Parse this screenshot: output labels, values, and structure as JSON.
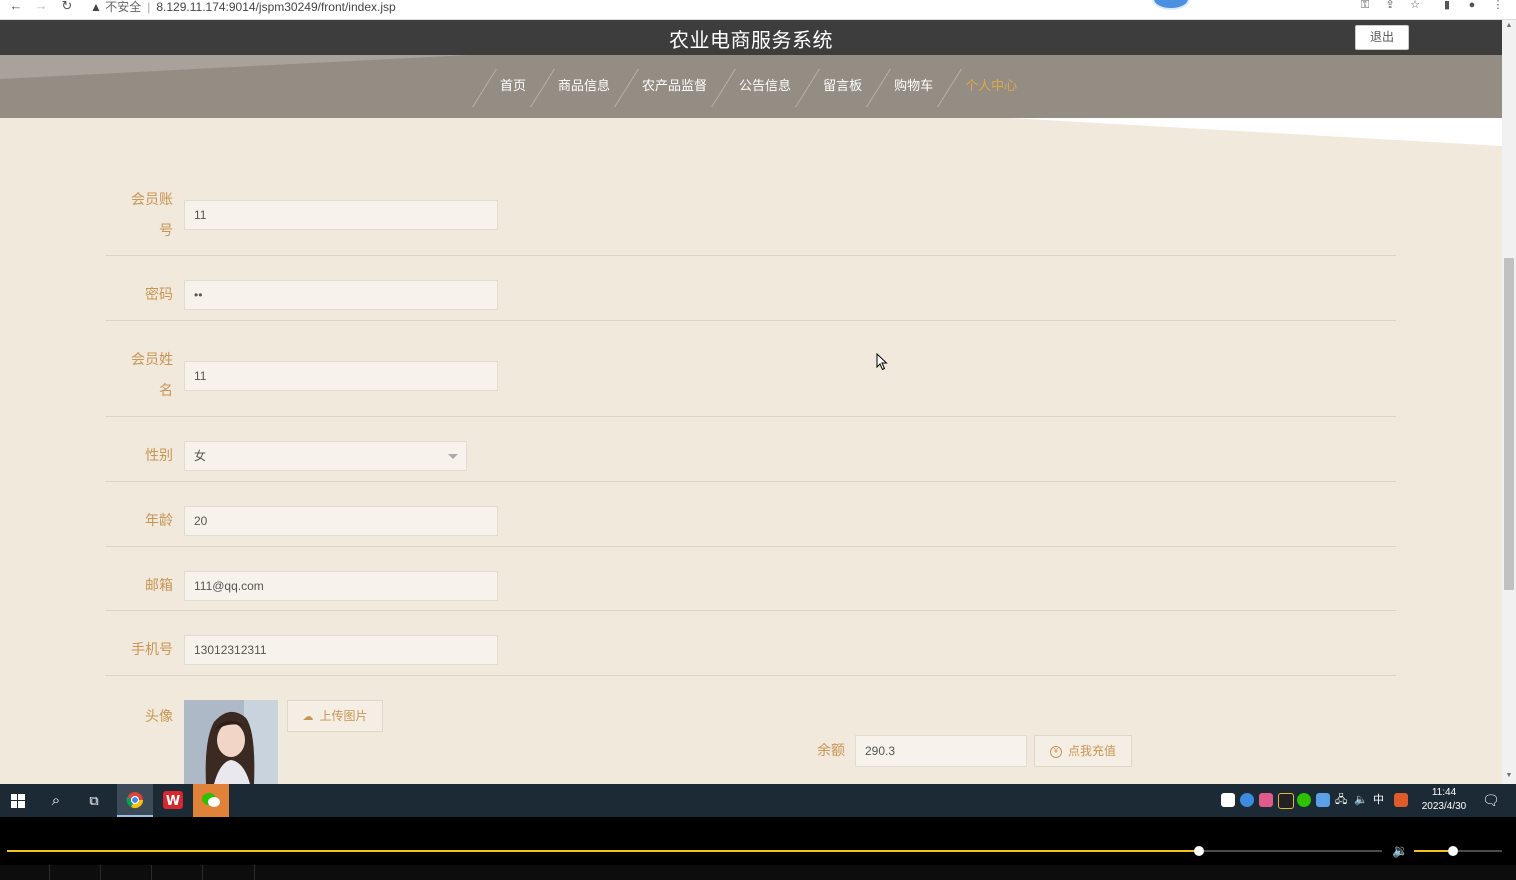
{
  "browser": {
    "insecure_label": "不安全",
    "url": "8.129.11.174:9014/jspm30249/front/index.jsp"
  },
  "header": {
    "title": "农业电商服务系统",
    "logout_label": "退出"
  },
  "nav": {
    "items": [
      {
        "label": "首页"
      },
      {
        "label": "商品信息"
      },
      {
        "label": "农产品监督"
      },
      {
        "label": "公告信息"
      },
      {
        "label": "留言板"
      },
      {
        "label": "购物车"
      },
      {
        "label": "个人中心",
        "active": true
      }
    ]
  },
  "form": {
    "account_label": "会员账号",
    "account_label_l1": "会员账",
    "account_label_l2": "号",
    "account_value": "11",
    "password_label": "密码",
    "password_value": "••",
    "name_label": "会员姓名",
    "name_label_l1": "会员姓",
    "name_label_l2": "名",
    "name_value": "11",
    "gender_label": "性别",
    "gender_value": "女",
    "age_label": "年龄",
    "age_value": "20",
    "email_label": "邮箱",
    "email_value": "111@qq.com",
    "phone_label": "手机号",
    "phone_value": "13012312311",
    "avatar_label": "头像",
    "upload_label": "上传图片",
    "balance_label": "余额",
    "balance_value": "290.3",
    "recharge_label": "点我充值"
  },
  "taskbar": {
    "ime_label": "中",
    "time": "11:44",
    "date": "2023/4/30"
  },
  "media": {
    "progress_fraction": 0.867,
    "volume_fraction": 0.44
  },
  "colors": {
    "accent": "#c79554",
    "active_nav": "#e0a74a",
    "header_bg": "#3d3d3d",
    "page_bg": "#f1e9dc"
  }
}
